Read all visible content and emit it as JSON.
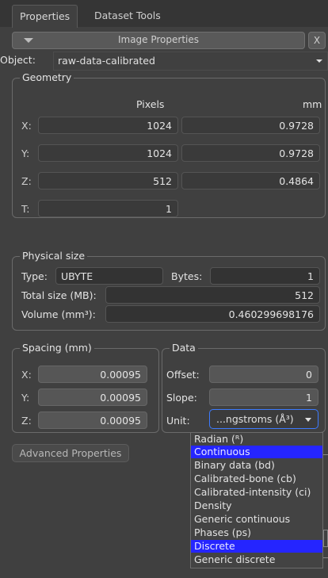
{
  "tabs": [
    {
      "label": "Properties"
    },
    {
      "label": "Dataset Tools"
    }
  ],
  "panel": {
    "title": "Image Properties",
    "close_label": "X"
  },
  "object": {
    "label": "Object:",
    "value": "raw-data-calibrated"
  },
  "geometry": {
    "title": "Geometry",
    "col_pixels": "Pixels",
    "col_mm": "mm",
    "rows": [
      {
        "label": "X:",
        "pixels": "1024",
        "mm": "0.9728"
      },
      {
        "label": "Y:",
        "pixels": "1024",
        "mm": "0.9728"
      },
      {
        "label": "Z:",
        "pixels": "512",
        "mm": "0.4864"
      },
      {
        "label": "T:",
        "pixels": "1"
      }
    ]
  },
  "physical": {
    "title": "Physical size",
    "type_label": "Type:",
    "type_value": "UBYTE",
    "bytes_label": "Bytes:",
    "bytes_value": "1",
    "total_label": "Total size (MB):",
    "total_value": "512",
    "volume_label": "Volume (mm³):",
    "volume_value": "0.460299698176"
  },
  "spacing": {
    "title": "Spacing (mm)",
    "rows": [
      {
        "label": "X:",
        "value": "0.00095"
      },
      {
        "label": "Y:",
        "value": "0.00095"
      },
      {
        "label": "Z:",
        "value": "0.00095"
      }
    ]
  },
  "data": {
    "title": "Data",
    "offset_label": "Offset:",
    "offset_value": "0",
    "slope_label": "Slope:",
    "slope_value": "1",
    "unit_label": "Unit:",
    "unit_value": "...ngstroms (Å³)"
  },
  "advanced_button": "Advanced Properties",
  "unit_options": [
    "Radian (ᴿ)",
    "Continuous",
    "Binary data (bd)",
    "Calibrated-bone (cb)",
    "Calibrated-intensity (ci)",
    "Density",
    "Generic continuous",
    "Phases (ps)",
    "Discrete",
    "Generic discrete"
  ],
  "unit_options_highlighted": [
    "Continuous",
    "Discrete"
  ],
  "colors": {
    "background": "#404040",
    "highlight": "#2525ff",
    "focus": "#3d7bff"
  }
}
